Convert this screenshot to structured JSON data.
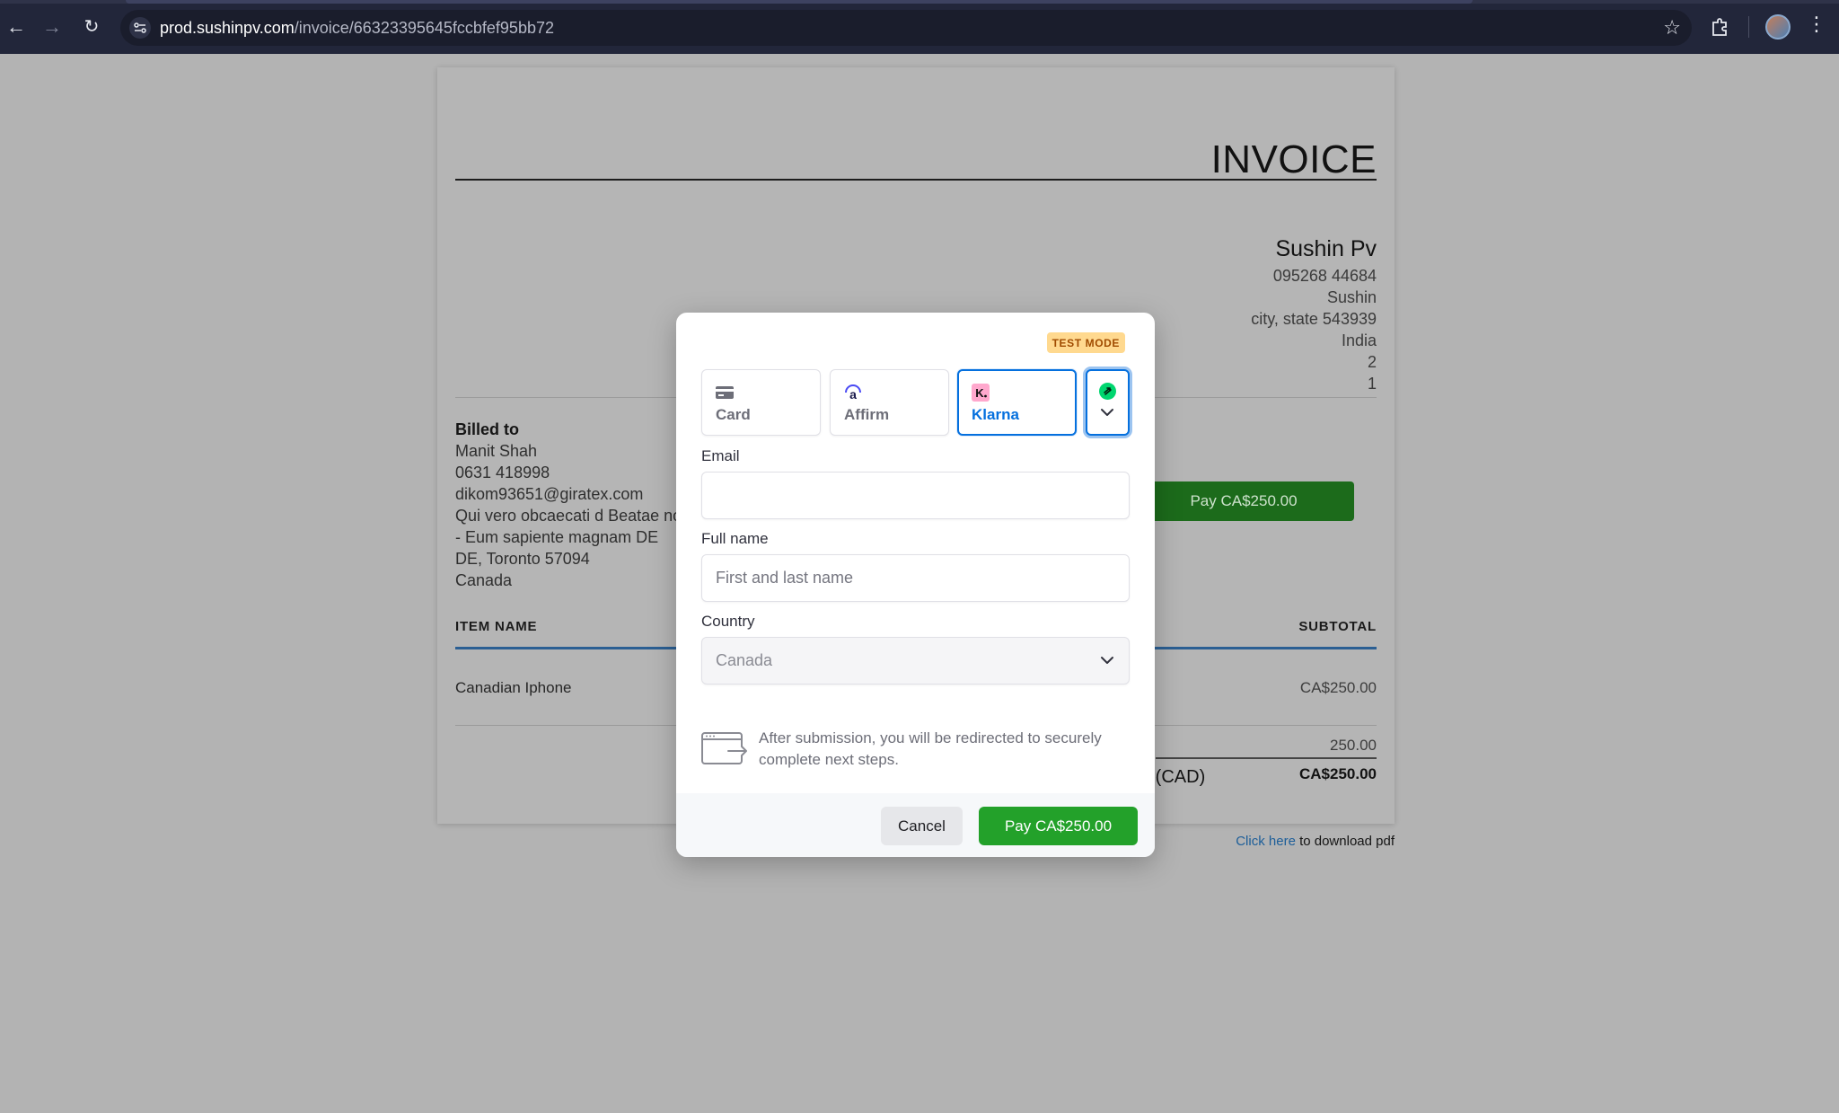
{
  "browser": {
    "url_host": "prod.sushinpv.com",
    "url_path": "/invoice/66323395645fccbfef95bb72",
    "icons": [
      "back-arrow-icon",
      "forward-arrow-icon",
      "reload-icon",
      "site-info-icon",
      "bookmark-star-icon",
      "extensions-icon",
      "profile-avatar",
      "more-vert-icon"
    ]
  },
  "invoice": {
    "title": "INVOICE",
    "seller": {
      "name": "Sushin Pv",
      "phone": "095268 44684",
      "line1": "Sushin",
      "line2": "city, state 543939",
      "country": "India",
      "line3": "2",
      "line4": "1"
    },
    "billed_to": {
      "label": "Billed to",
      "name": "Manit Shah",
      "phone": "0631 418998",
      "email": "dikom93651@giratex.com",
      "address1": "Qui vero obcaecati d Beatae nor",
      "address2": "- Eum sapiente magnam DE",
      "address3": "DE, Toronto 57094",
      "country": "Canada"
    },
    "pay_button": "Pay CA$250.00",
    "table": {
      "col_item": "ITEM NAME",
      "col_subtotal": "SUBTOTAL",
      "rows": [
        {
          "item": "Canadian Iphone",
          "subtotal": "CA$250.00"
        }
      ]
    },
    "summary_value": "250.00",
    "total_label": "e (CAD)",
    "total_value": "CA$250.00",
    "pdf_link": "Click here",
    "pdf_text": " to download pdf"
  },
  "modal": {
    "badge": "TEST MODE",
    "methods": [
      {
        "label": "Card",
        "icon": "card-icon",
        "selected": false
      },
      {
        "label": "Affirm",
        "icon": "affirm-icon",
        "selected": false
      },
      {
        "label": "Klarna",
        "icon": "klarna-icon",
        "selected": true
      }
    ],
    "more_methods_icon": "link-icon",
    "email_label": "Email",
    "email_value": "",
    "fullname_label": "Full name",
    "fullname_placeholder": "First and last name",
    "country_label": "Country",
    "country_value": "Canada",
    "redirect_text": "After submission, you will be redirected to securely complete next steps.",
    "cancel": "Cancel",
    "pay": "Pay CA$250.00"
  },
  "colors": {
    "accent": "#0570de",
    "pay_green": "#23a12a",
    "testmode_bg": "#ffd98f",
    "klarna_pink": "#ffa8cd",
    "link_green": "#00d66f"
  }
}
